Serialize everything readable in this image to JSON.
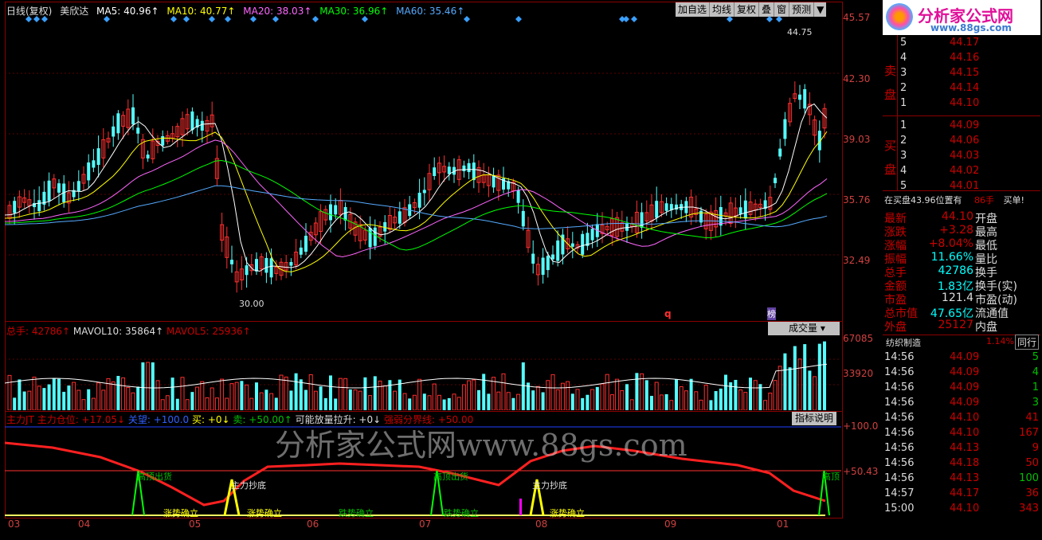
{
  "colors": {
    "up": "#ff3030",
    "down": "#54ffff",
    "ma5": "#ffffff",
    "ma10": "#ffff00",
    "ma20": "#ff66ff",
    "ma30": "#00ff00",
    "ma60": "#55aaff",
    "grid": "#5a0000"
  },
  "header": {
    "title": "日线(复权)",
    "stock": "美欣达",
    "ma": [
      {
        "label": "MA5: 40.96↑"
      },
      {
        "label": "MA10: 40.77↑"
      },
      {
        "label": "MA20: 38.03↑"
      },
      {
        "label": "MA30: 36.96↑"
      },
      {
        "label": "MA60: 35.46↑"
      }
    ],
    "toolbar": [
      "加自选",
      "均线",
      "复权",
      "叠",
      "窗",
      "预测",
      "▼"
    ]
  },
  "main_chart": {
    "y_ticks": [
      "45.57",
      "42.30",
      "39.03",
      "35.76",
      "32.49"
    ],
    "high_mark": "44.75",
    "low_mark": "30.00",
    "marker_q": "q",
    "marker_bang": "榜"
  },
  "volume_chart": {
    "legend": {
      "total": "总手: 42786↑",
      "mavol10": "MAVOL10: 35864↑",
      "mavol5": "MAVOL5: 25936↑"
    },
    "y_ticks": [
      "67085",
      "33920"
    ],
    "button": "成交量"
  },
  "indicator_chart": {
    "legend": {
      "name": "主力JT",
      "pos": "主力仓位: +17.05↓",
      "kongwang": "关望: +100.0",
      "buy": "买: +0↓",
      "sell": "卖: +50.00↑",
      "pull": "可能放量拉升: +0↓",
      "strong": "强弱分界线: +50.00"
    },
    "y_ticks": [
      "+100.0",
      "+50.43"
    ],
    "button": "指标说明",
    "annotations": [
      "高顶出货",
      "主力抄底",
      "涨势确立",
      "跌势确立",
      "高顶出货",
      "主力抄底",
      "涨势确立",
      "跌势确立",
      "涨势确立",
      "高顶"
    ]
  },
  "x_labels": [
    "03",
    "04",
    "05",
    "06",
    "07",
    "08",
    "09",
    "01"
  ],
  "watermark": "分析家公式网www.88gs.com",
  "brand": {
    "name": "分析家公式网",
    "url": "www.88gs.com"
  },
  "order_book": {
    "sell_label": "卖盘",
    "buy_label": "买盘",
    "sells": [
      {
        "n": "5",
        "price": "44.17"
      },
      {
        "n": "4",
        "price": "44.16"
      },
      {
        "n": "3",
        "price": "44.15"
      },
      {
        "n": "2",
        "price": "44.14"
      },
      {
        "n": "1",
        "price": "44.10"
      }
    ],
    "buys": [
      {
        "n": "1",
        "price": "44.09"
      },
      {
        "n": "2",
        "price": "44.06"
      },
      {
        "n": "3",
        "price": "44.03"
      },
      {
        "n": "4",
        "price": "44.02"
      },
      {
        "n": "5",
        "price": "44.01"
      }
    ],
    "status": "在买盘43.96位置有",
    "status_qty": "86手",
    "status_btn": "买单!"
  },
  "quote": [
    {
      "k": "最新",
      "v": "44.10",
      "k2": "开盘"
    },
    {
      "k": "涨跌",
      "v": "+3.28",
      "k2": "最高"
    },
    {
      "k": "涨幅",
      "v": "+8.04%",
      "k2": "最低"
    },
    {
      "k": "振幅",
      "v": "11.66%",
      "k2": "量比"
    },
    {
      "k": "总手",
      "v": "42786",
      "k2": "换手"
    },
    {
      "k": "金额",
      "v": "1.83亿",
      "k2": "换手(实)"
    },
    {
      "k": "市盈",
      "v": "121.4",
      "k2": "市盈(动)"
    },
    {
      "k": "总市值",
      "v": "47.65亿",
      "k2": "流通值"
    },
    {
      "k": "外盘",
      "v": "25127",
      "k2": "内盘"
    }
  ],
  "industry": {
    "name": "纺织制造",
    "pct": "1.14%",
    "btn": "同行"
  },
  "ticks": [
    {
      "t": "14:56",
      "p": "44.09",
      "v": "5"
    },
    {
      "t": "14:56",
      "p": "44.09",
      "v": "4"
    },
    {
      "t": "14:56",
      "p": "44.09",
      "v": "1"
    },
    {
      "t": "14:56",
      "p": "44.09",
      "v": "3"
    },
    {
      "t": "14:56",
      "p": "44.10",
      "v": "41"
    },
    {
      "t": "14:56",
      "p": "44.10",
      "v": "167"
    },
    {
      "t": "14:56",
      "p": "44.13",
      "v": "9"
    },
    {
      "t": "14:56",
      "p": "44.18",
      "v": "50"
    },
    {
      "t": "14:56",
      "p": "44.13",
      "v": "100"
    },
    {
      "t": "14:57",
      "p": "44.17",
      "v": "36"
    },
    {
      "t": "15:00",
      "p": "44.10",
      "v": "343"
    }
  ]
}
